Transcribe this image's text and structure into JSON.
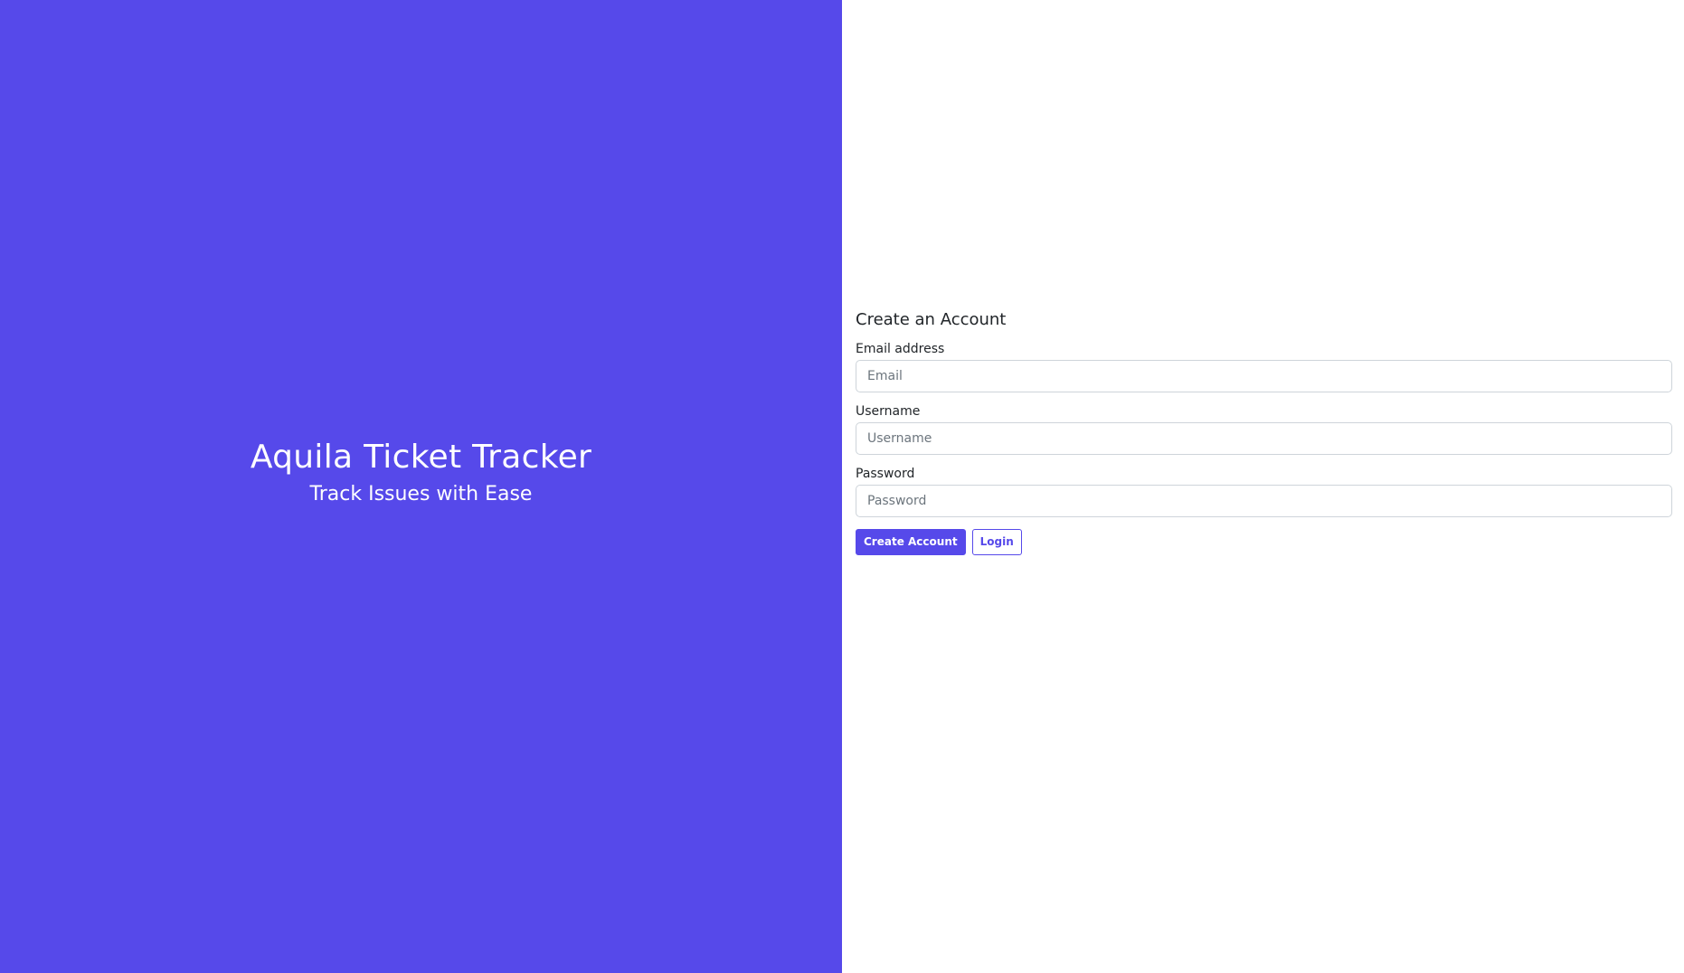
{
  "brand": {
    "title": "Aquila Ticket Tracker",
    "tagline": "Track Issues with Ease"
  },
  "form": {
    "heading": "Create an Account",
    "email": {
      "label": "Email address",
      "placeholder": "Email",
      "value": ""
    },
    "username": {
      "label": "Username",
      "placeholder": "Username",
      "value": ""
    },
    "password": {
      "label": "Password",
      "placeholder": "Password",
      "value": ""
    },
    "create_label": "Create Account",
    "login_label": "Login"
  },
  "colors": {
    "brand": "#5649ea",
    "background": "#ffffff"
  }
}
